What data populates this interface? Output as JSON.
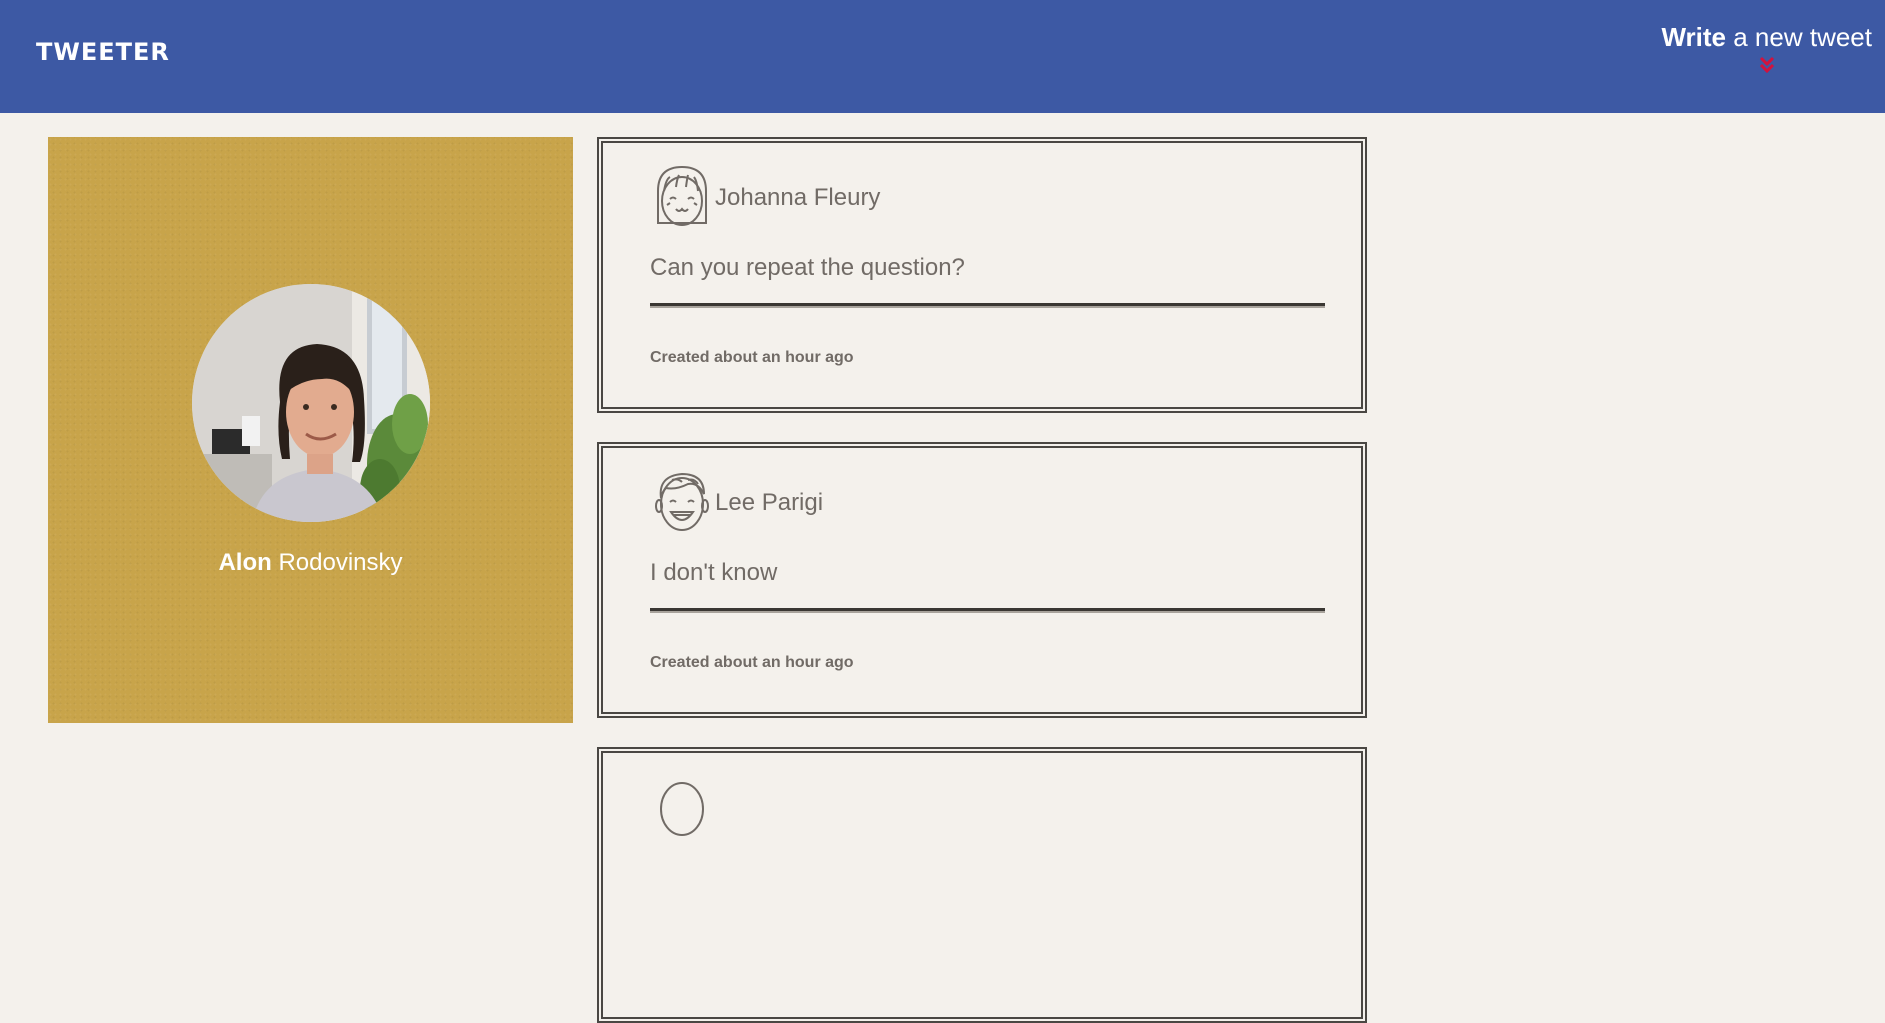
{
  "header": {
    "logo": "TWEETER",
    "compose_bold": "Write",
    "compose_rest": " a new tweet",
    "compose_chevron_color": "#d2123e"
  },
  "profile": {
    "first_name": "Alon",
    "last_name": " Rodovinsky",
    "panel_color": "#c8a44a"
  },
  "tweets": [
    {
      "author": "Johanna Fleury",
      "avatar_icon": "girl-face-icon",
      "text": "Can you repeat the question?",
      "timestamp": "Created about an hour ago"
    },
    {
      "author": "Lee Parigi",
      "avatar_icon": "laughing-boy-face-icon",
      "text": "I don't know",
      "timestamp": "Created about an hour ago"
    },
    {
      "author": "",
      "avatar_icon": "face-icon",
      "text": "",
      "timestamp": ""
    }
  ]
}
